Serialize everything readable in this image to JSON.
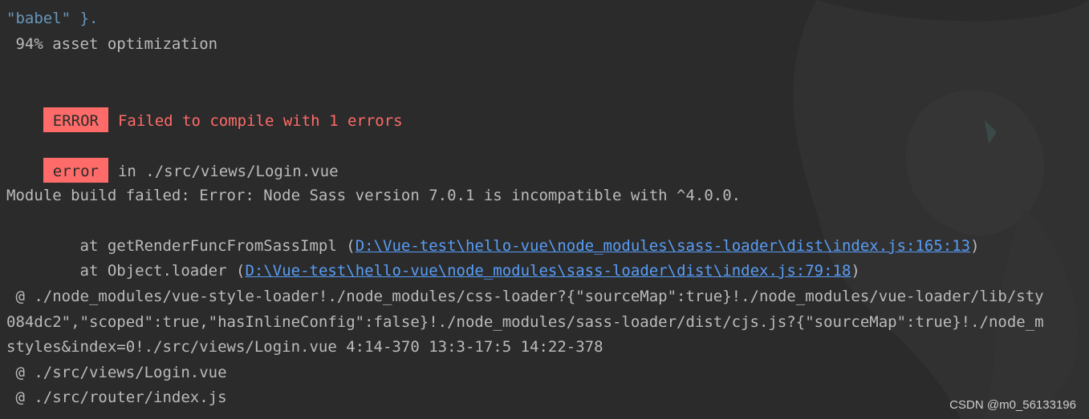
{
  "lines": {
    "l1": "\"babel\" }.",
    "l2": " 94% asset optimization",
    "l3_badge": "ERROR",
    "l3_text": "Failed to compile with 1 errors",
    "l4_badge": "error",
    "l4_text": "in ./src/views/Login.vue",
    "l5": "Module build failed: Error: Node Sass version 7.0.1 is incompatible with ^4.0.0.",
    "l6_prefix": "    at getRenderFuncFromSassImpl (",
    "l6_link": "D:\\Vue-test\\hello-vue\\node_modules\\sass-loader\\dist\\index.js:165:13",
    "l6_suffix": ")",
    "l7_prefix": "    at Object.loader (",
    "l7_link": "D:\\Vue-test\\hello-vue\\node_modules\\sass-loader\\dist\\index.js:79:18",
    "l7_suffix": ")",
    "l8": " @ ./node_modules/vue-style-loader!./node_modules/css-loader?{\"sourceMap\":true}!./node_modules/vue-loader/lib/sty",
    "l9": "084dc2\",\"scoped\":true,\"hasInlineConfig\":false}!./node_modules/sass-loader/dist/cjs.js?{\"sourceMap\":true}!./node_m",
    "l10": "styles&index=0!./src/views/Login.vue 4:14-370 13:3-17:5 14:22-378",
    "l11": " @ ./src/views/Login.vue",
    "l12": " @ ./src/router/index.js"
  },
  "watermark": "CSDN @m0_56133196",
  "colors": {
    "background": "#2b2b2b",
    "text": "#bbbbbb",
    "error_red": "#ff6b68",
    "link_blue": "#589df6",
    "string_blue": "#6897bb"
  }
}
